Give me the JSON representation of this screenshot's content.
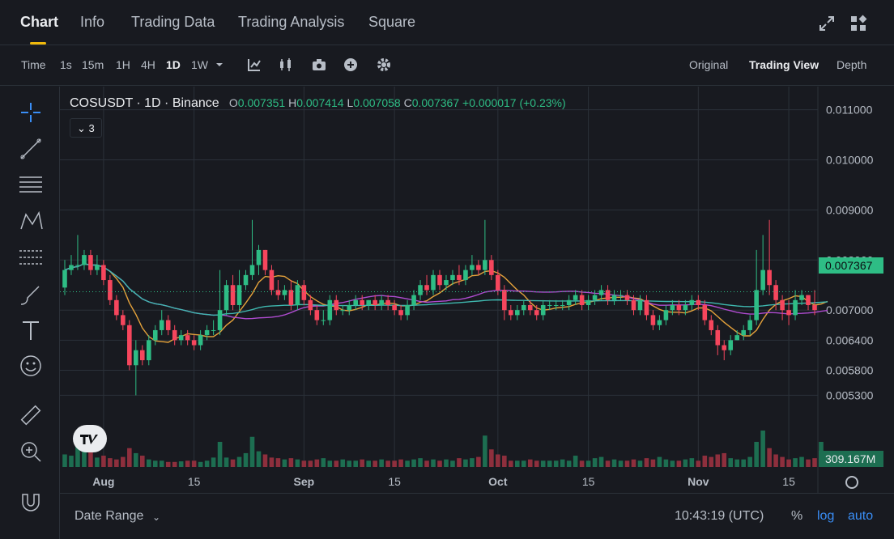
{
  "nav": {
    "tabs": [
      "Chart",
      "Info",
      "Trading Data",
      "Trading Analysis",
      "Square"
    ],
    "active": "Chart"
  },
  "toolbar": {
    "intervals": [
      "Time",
      "1s",
      "15m",
      "1H",
      "4H",
      "1D",
      "1W"
    ],
    "active_interval": "1D",
    "views": [
      "Original",
      "Trading View",
      "Depth"
    ],
    "active_view": "Trading View"
  },
  "legend": {
    "symbol": "COSUSDT · 1D · Binance",
    "o_label": "O",
    "o": "0.007351",
    "h_label": "H",
    "h": "0.007414",
    "l_label": "L",
    "l": "0.007058",
    "c_label": "C",
    "c": "0.007367",
    "change": "+0.000017 (+0.23%)",
    "indicator_count": "3"
  },
  "axis": {
    "price_ticks": [
      "0.011000",
      "0.010000",
      "0.009000",
      "0.008000",
      "0.007000",
      "0.006400",
      "0.005800",
      "0.005300"
    ],
    "time_ticks": [
      "Aug",
      "15",
      "Sep",
      "15",
      "Oct",
      "15",
      "Nov",
      "15"
    ],
    "last_price": "0.007367",
    "volume_label": "309.167M"
  },
  "footer": {
    "date_range": "Date Range",
    "clock": "10:43:19 (UTC)",
    "percent": "%",
    "log": "log",
    "auto": "auto"
  },
  "colors": {
    "up": "#2ebd85",
    "down": "#f6465d",
    "ma_short": "#e5a23b",
    "ma_mid": "#b04cd1",
    "ma_long": "#3fb8af",
    "accent": "#f0b90b",
    "link": "#3a8ef6"
  },
  "chart_data": {
    "type": "candlestick",
    "x": [
      "07-26",
      "07-27",
      "07-28",
      "07-29",
      "07-30",
      "07-31",
      "08-01",
      "08-02",
      "08-03",
      "08-04",
      "08-05",
      "08-06",
      "08-07",
      "08-08",
      "08-09",
      "08-10",
      "08-11",
      "08-12",
      "08-13",
      "08-14",
      "08-15",
      "08-16",
      "08-17",
      "08-18",
      "08-19",
      "08-20",
      "08-21",
      "08-22",
      "08-23",
      "08-24",
      "08-25",
      "08-26",
      "08-27",
      "08-28",
      "08-29",
      "08-30",
      "08-31",
      "09-01",
      "09-02",
      "09-03",
      "09-04",
      "09-05",
      "09-06",
      "09-07",
      "09-08",
      "09-09",
      "09-10",
      "09-11",
      "09-12",
      "09-13",
      "09-14",
      "09-15",
      "09-16",
      "09-17",
      "09-18",
      "09-19",
      "09-20",
      "09-21",
      "09-22",
      "09-23",
      "09-24",
      "09-25",
      "09-26",
      "09-27",
      "09-28",
      "09-29",
      "09-30",
      "10-01",
      "10-02",
      "10-03",
      "10-04",
      "10-05",
      "10-06",
      "10-07",
      "10-08",
      "10-09",
      "10-10",
      "10-11",
      "10-12",
      "10-13",
      "10-14",
      "10-15",
      "10-16",
      "10-17",
      "10-18",
      "10-19",
      "10-20",
      "10-21",
      "10-22",
      "10-23",
      "10-24",
      "10-25",
      "10-26",
      "10-27",
      "10-28",
      "10-29",
      "10-30",
      "10-31",
      "11-01",
      "11-02",
      "11-03",
      "11-04",
      "11-05",
      "11-06",
      "11-07",
      "11-08",
      "11-09",
      "11-10",
      "11-11",
      "11-12",
      "11-13",
      "11-14",
      "11-15",
      "11-16",
      "11-17",
      "11-18",
      "11-19"
    ],
    "series": [
      {
        "name": "open",
        "values": [
          0.00745,
          0.0078,
          0.0079,
          0.0079,
          0.0081,
          0.0078,
          0.0079,
          0.0076,
          0.0072,
          0.0069,
          0.0067,
          0.0059,
          0.0062,
          0.006,
          0.0064,
          0.0066,
          0.0068,
          0.0066,
          0.0064,
          0.0065,
          0.0064,
          0.0063,
          0.0065,
          0.0066,
          0.0066,
          0.007,
          0.0075,
          0.0071,
          0.0075,
          0.0077,
          0.0079,
          0.0082,
          0.0078,
          0.0074,
          0.0073,
          0.0074,
          0.0071,
          0.0075,
          0.0072,
          0.007,
          0.0068,
          0.0068,
          0.0072,
          0.007,
          0.007,
          0.0071,
          0.0072,
          0.0071,
          0.0072,
          0.0071,
          0.0072,
          0.0071,
          0.007,
          0.0069,
          0.0071,
          0.0073,
          0.0075,
          0.0074,
          0.0077,
          0.0075,
          0.0076,
          0.0077,
          0.0076,
          0.0078,
          0.0079,
          0.0078,
          0.008,
          0.0077,
          0.0074,
          0.007,
          0.0069,
          0.007,
          0.0071,
          0.007,
          0.0069,
          0.0071,
          0.0071,
          0.0071,
          0.0071,
          0.0072,
          0.0073,
          0.0071,
          0.0072,
          0.0073,
          0.0074,
          0.0072,
          0.0073,
          0.0073,
          0.0072,
          0.007,
          0.0072,
          0.0069,
          0.0067,
          0.0068,
          0.007,
          0.0071,
          0.007,
          0.0071,
          0.0072,
          0.0071,
          0.0068,
          0.0066,
          0.0063,
          0.0062,
          0.0064,
          0.0065,
          0.0066,
          0.0068,
          0.0074,
          0.0078,
          0.0075,
          0.0072,
          0.007,
          0.0069,
          0.0072,
          0.0073,
          0.0071,
          0.007,
          0.00735
        ]
      },
      {
        "name": "close",
        "values": [
          0.0078,
          0.0079,
          0.0079,
          0.0081,
          0.0078,
          0.0079,
          0.0076,
          0.0072,
          0.0069,
          0.0067,
          0.0059,
          0.0062,
          0.006,
          0.0064,
          0.0066,
          0.0068,
          0.0066,
          0.0064,
          0.0065,
          0.0064,
          0.0063,
          0.0065,
          0.0066,
          0.0066,
          0.007,
          0.0075,
          0.0071,
          0.0075,
          0.0077,
          0.0079,
          0.0082,
          0.0078,
          0.0074,
          0.0073,
          0.0074,
          0.0071,
          0.0075,
          0.0072,
          0.007,
          0.0068,
          0.0068,
          0.0072,
          0.007,
          0.007,
          0.0071,
          0.0072,
          0.0071,
          0.0072,
          0.0071,
          0.0072,
          0.0071,
          0.007,
          0.0069,
          0.0071,
          0.0073,
          0.0075,
          0.0074,
          0.0077,
          0.0075,
          0.0076,
          0.0077,
          0.0076,
          0.0078,
          0.0079,
          0.0078,
          0.008,
          0.0077,
          0.0074,
          0.007,
          0.0069,
          0.007,
          0.0071,
          0.007,
          0.0069,
          0.0071,
          0.0071,
          0.0071,
          0.0071,
          0.0072,
          0.0073,
          0.0071,
          0.0072,
          0.0073,
          0.0074,
          0.0072,
          0.0073,
          0.0073,
          0.0072,
          0.007,
          0.0072,
          0.0069,
          0.0067,
          0.0068,
          0.007,
          0.0071,
          0.007,
          0.0071,
          0.0072,
          0.0071,
          0.0068,
          0.0066,
          0.0063,
          0.0062,
          0.0064,
          0.0065,
          0.0066,
          0.0068,
          0.0074,
          0.0078,
          0.0075,
          0.0072,
          0.007,
          0.0069,
          0.0072,
          0.0073,
          0.0071,
          0.007,
          0.00735,
          0.007367
        ]
      },
      {
        "name": "high",
        "values": [
          0.008,
          0.0081,
          0.0085,
          0.0082,
          0.0082,
          0.0081,
          0.008,
          0.0077,
          0.0073,
          0.007,
          0.0068,
          0.0064,
          0.0063,
          0.0065,
          0.0067,
          0.007,
          0.0069,
          0.0067,
          0.0066,
          0.0066,
          0.0065,
          0.0066,
          0.0067,
          0.0068,
          0.0078,
          0.0076,
          0.0077,
          0.0078,
          0.0078,
          0.0088,
          0.0083,
          0.0082,
          0.0079,
          0.0076,
          0.0075,
          0.0076,
          0.0076,
          0.0076,
          0.0073,
          0.0071,
          0.007,
          0.0073,
          0.0073,
          0.0071,
          0.0072,
          0.0073,
          0.0073,
          0.0072,
          0.0073,
          0.0073,
          0.0073,
          0.0072,
          0.0071,
          0.0072,
          0.0074,
          0.0076,
          0.0077,
          0.0078,
          0.0078,
          0.0077,
          0.0078,
          0.0079,
          0.0079,
          0.0081,
          0.008,
          0.0088,
          0.0081,
          0.0078,
          0.0075,
          0.0071,
          0.0071,
          0.0072,
          0.0072,
          0.0071,
          0.0072,
          0.0072,
          0.0072,
          0.0072,
          0.0073,
          0.0074,
          0.0074,
          0.0073,
          0.0074,
          0.0075,
          0.0075,
          0.0074,
          0.0074,
          0.0074,
          0.0073,
          0.0073,
          0.0073,
          0.007,
          0.0069,
          0.0071,
          0.0072,
          0.0072,
          0.0072,
          0.0073,
          0.0073,
          0.0072,
          0.0069,
          0.0067,
          0.0064,
          0.0065,
          0.0066,
          0.0067,
          0.0069,
          0.0082,
          0.0085,
          0.0088,
          0.0076,
          0.0073,
          0.0072,
          0.0074,
          0.0074,
          0.0073,
          0.0074,
          0.0081,
          0.00741
        ]
      },
      {
        "name": "low",
        "values": [
          0.0073,
          0.0077,
          0.0078,
          0.0078,
          0.0077,
          0.0077,
          0.0075,
          0.0071,
          0.0068,
          0.0066,
          0.0058,
          0.0053,
          0.0059,
          0.0059,
          0.0063,
          0.0065,
          0.0065,
          0.0063,
          0.0063,
          0.0063,
          0.0062,
          0.0062,
          0.0064,
          0.0065,
          0.0065,
          0.0069,
          0.007,
          0.007,
          0.0074,
          0.0076,
          0.0077,
          0.0077,
          0.0073,
          0.0072,
          0.0072,
          0.007,
          0.007,
          0.0071,
          0.0069,
          0.0067,
          0.0067,
          0.0067,
          0.0069,
          0.0069,
          0.0069,
          0.007,
          0.007,
          0.007,
          0.007,
          0.007,
          0.007,
          0.0069,
          0.0068,
          0.0068,
          0.007,
          0.0072,
          0.0073,
          0.0073,
          0.0074,
          0.0074,
          0.0075,
          0.0075,
          0.0075,
          0.0077,
          0.0077,
          0.0077,
          0.0076,
          0.0073,
          0.0068,
          0.0068,
          0.0068,
          0.0069,
          0.0069,
          0.0068,
          0.0068,
          0.007,
          0.007,
          0.007,
          0.007,
          0.0071,
          0.007,
          0.007,
          0.0071,
          0.0072,
          0.0071,
          0.0071,
          0.0072,
          0.0071,
          0.0069,
          0.0069,
          0.0068,
          0.0066,
          0.0066,
          0.0067,
          0.0069,
          0.0069,
          0.0069,
          0.007,
          0.007,
          0.0067,
          0.0065,
          0.0061,
          0.006,
          0.0061,
          0.0064,
          0.0064,
          0.0065,
          0.0067,
          0.0073,
          0.0073,
          0.007,
          0.0068,
          0.0067,
          0.0068,
          0.0071,
          0.007,
          0.0069,
          0.0069,
          0.007058
        ]
      },
      {
        "name": "volume",
        "values": [
          20,
          18,
          45,
          30,
          25,
          15,
          18,
          14,
          12,
          16,
          30,
          22,
          18,
          12,
          10,
          10,
          8,
          8,
          9,
          10,
          10,
          8,
          10,
          15,
          40,
          15,
          12,
          16,
          22,
          48,
          25,
          20,
          15,
          14,
          12,
          14,
          12,
          10,
          10,
          12,
          14,
          10,
          10,
          12,
          10,
          10,
          12,
          10,
          10,
          12,
          10,
          10,
          12,
          10,
          12,
          14,
          10,
          12,
          10,
          12,
          10,
          14,
          12,
          14,
          16,
          50,
          28,
          20,
          18,
          10,
          10,
          10,
          12,
          10,
          10,
          10,
          10,
          12,
          10,
          18,
          10,
          10,
          14,
          16,
          10,
          12,
          10,
          10,
          12,
          10,
          14,
          12,
          16,
          12,
          10,
          10,
          12,
          14,
          10,
          18,
          16,
          20,
          22,
          14,
          12,
          12,
          16,
          40,
          58,
          30,
          20,
          16,
          12,
          14,
          16,
          12,
          14,
          40,
          8
        ]
      }
    ],
    "ylim": [
      0.005,
      0.0113
    ],
    "log_scale": false,
    "grid": true
  }
}
